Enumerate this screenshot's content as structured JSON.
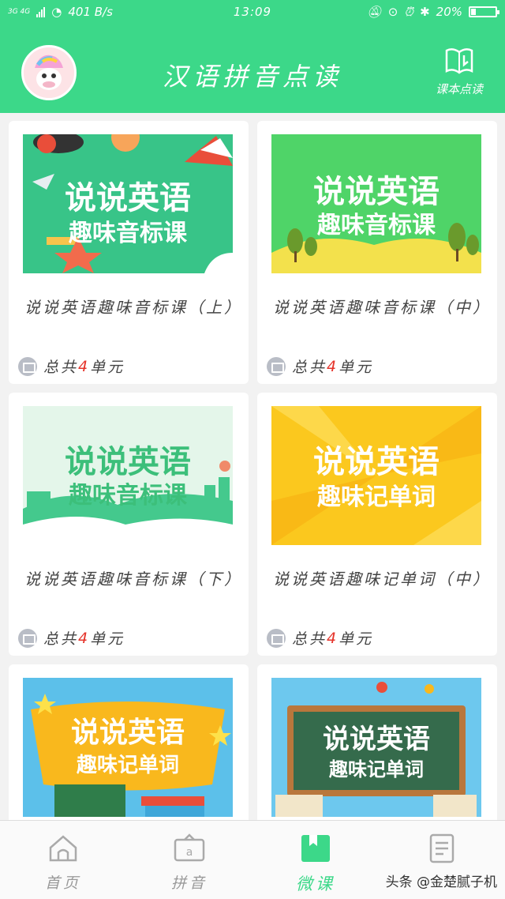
{
  "status_bar": {
    "network": "3G 4G",
    "speed": "401 B/s",
    "time": "13:09",
    "battery_percent": "20%",
    "battery_level": 0.2
  },
  "header": {
    "title": "汉语拼音点读",
    "book_button_label": "课本点读",
    "accent_color": "#3cd889"
  },
  "courses": [
    {
      "banner_line1": "说说英语",
      "banner_line2": "趣味音标课",
      "name": "说说英语趣味音标课（上）",
      "meta_prefix": "总共",
      "meta_count": "4",
      "meta_suffix": "单元"
    },
    {
      "banner_line1": "说说英语",
      "banner_line2": "趣味音标课",
      "name": "说说英语趣味音标课（中）",
      "meta_prefix": "总共",
      "meta_count": "4",
      "meta_suffix": "单元"
    },
    {
      "banner_line1": "说说英语",
      "banner_line2": "趣味音标课",
      "name": "说说英语趣味音标课（下）",
      "meta_prefix": "总共",
      "meta_count": "4",
      "meta_suffix": "单元"
    },
    {
      "banner_line1": "说说英语",
      "banner_line2": "趣味记单词",
      "name": "说说英语趣味记单词（中）",
      "meta_prefix": "总共",
      "meta_count": "4",
      "meta_suffix": "单元"
    },
    {
      "banner_line1": "说说英语",
      "banner_line2": "趣味记单词"
    },
    {
      "banner_line1": "说说英语",
      "banner_line2": "趣味记单词"
    }
  ],
  "tabs": [
    {
      "label": "首页",
      "icon": "home-icon"
    },
    {
      "label": "拼音",
      "icon": "pinyin-icon"
    },
    {
      "label": "微课",
      "icon": "micro-lesson-icon",
      "active": true
    },
    {
      "label": "",
      "icon": "document-icon"
    }
  ],
  "watermark": "头条 @金楚腻子机"
}
